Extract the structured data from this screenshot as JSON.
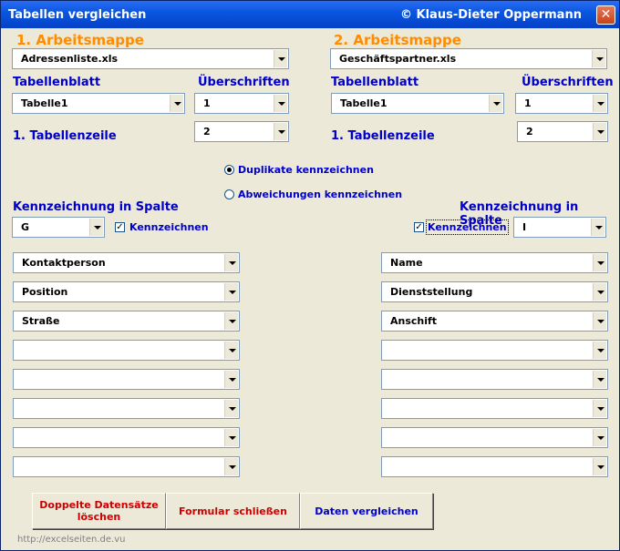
{
  "window": {
    "title": "Tabellen vergleichen",
    "author": "© Klaus-Dieter Oppermann",
    "close_symbol": "✕"
  },
  "left": {
    "heading": "1. Arbeitsmappe",
    "workbook": "Adressenliste.xls",
    "sheet_label": "Tabellenblatt",
    "sheet": "Tabelle1",
    "headers_label": "Überschriften",
    "headers": "1",
    "first_row_label": "1. Tabellenzeile",
    "first_row": "2",
    "mark_column_label": "Kennzeichnung in Spalte",
    "mark_column": "G",
    "mark_checkbox_label": "Kennzeichnen",
    "mark_checked": true,
    "fields": [
      "Kontaktperson",
      "Position",
      "Straße",
      "",
      "",
      "",
      "",
      ""
    ]
  },
  "right": {
    "heading": "2. Arbeitsmappe",
    "workbook": "Geschäftspartner.xls",
    "sheet_label": "Tabellenblatt",
    "sheet": "Tabelle1",
    "headers_label": "Überschriften",
    "headers": "1",
    "first_row_label": "1. Tabellenzeile",
    "first_row": "2",
    "mark_column_label": "Kennzeichnung in Spalte",
    "mark_column": "I",
    "mark_checkbox_label": "Kennzeichnen",
    "mark_checked": true,
    "fields": [
      "Name",
      "Dienststellung",
      "Anschift",
      "",
      "",
      "",
      "",
      ""
    ]
  },
  "mode": {
    "duplicates_label": "Duplikate kennzeichnen",
    "differences_label": "Abweichungen kennzeichnen",
    "selected": "duplicates"
  },
  "buttons": {
    "delete_duplicates": "Doppelte Datensätze löschen",
    "close_form": "Formular schließen",
    "compare": "Daten vergleichen"
  },
  "footer": "http://excelseiten.de.vu",
  "colors": {
    "title_bar": "#0b57e0",
    "heading_orange": "#ff8c00",
    "label_blue": "#0000cc",
    "button_red": "#cc0000",
    "background": "#ece9d8"
  }
}
